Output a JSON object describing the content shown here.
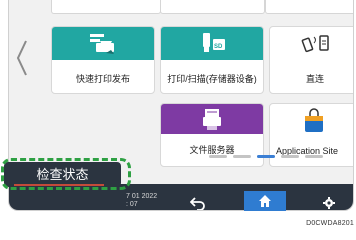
{
  "tiles": [
    {
      "label": "快速打印发布",
      "icon": "printer-release-icon"
    },
    {
      "label": "打印/扫描(存储器设备)",
      "icon": "usb-sd-icon"
    },
    {
      "label": "直连",
      "icon": "phone-nfc-icon"
    },
    {
      "label": "文件服务器",
      "icon": "document-server-icon"
    },
    {
      "label": "Application Site",
      "icon": "shopping-bag-icon"
    }
  ],
  "status_button": {
    "label": "检查状态"
  },
  "datetime": {
    "date": "7 01 2022",
    "time": ": 07"
  },
  "nav": {
    "back_icon": "back-arrow-icon",
    "home_icon": "home-icon",
    "settings_icon": "gear-icon"
  },
  "caption": "D0CWDA8201",
  "colors": {
    "teal": "#21a7a2",
    "purple": "#7e3aa3",
    "bar": "#2b3440",
    "home": "#2f7cd1",
    "highlight": "#2ea043"
  }
}
